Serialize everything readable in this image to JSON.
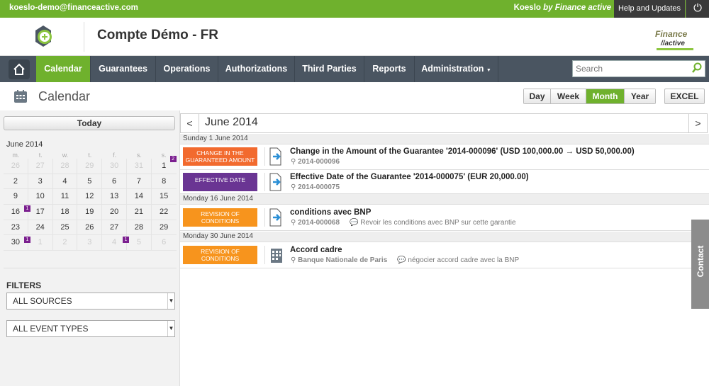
{
  "topbar": {
    "email": "koeslo-demo@financeactive.com",
    "brand_a": "Koeslo",
    "brand_b": "by Finance active",
    "help": "Help and Updates"
  },
  "header": {
    "title": "Compte Démo - FR"
  },
  "nav": {
    "items": [
      "Calendar",
      "Guarantees",
      "Operations",
      "Authorizations",
      "Third Parties",
      "Reports",
      "Administration"
    ],
    "search_placeholder": "Search"
  },
  "page": {
    "title": "Calendar",
    "views": [
      "Day",
      "Week",
      "Month",
      "Year"
    ],
    "active_view": "Month",
    "excel": "EXCEL"
  },
  "sidebar": {
    "today": "Today",
    "month_title": "June 2014",
    "dow": [
      "m.",
      "t.",
      "w.",
      "t.",
      "f.",
      "s.",
      "s."
    ],
    "weeks": [
      [
        "26",
        "27",
        "28",
        "29",
        "30",
        "31",
        "1"
      ],
      [
        "2",
        "3",
        "4",
        "5",
        "6",
        "7",
        "8"
      ],
      [
        "9",
        "10",
        "11",
        "12",
        "13",
        "14",
        "15"
      ],
      [
        "16",
        "17",
        "18",
        "19",
        "20",
        "21",
        "22"
      ],
      [
        "23",
        "24",
        "25",
        "26",
        "27",
        "28",
        "29"
      ],
      [
        "30",
        "1",
        "2",
        "3",
        "4",
        "5",
        "6"
      ]
    ],
    "badges": {
      "w0d6": "2",
      "w3d0": "1",
      "w5d0": "1",
      "w5d4": "1"
    },
    "filters_label": "FILTERS",
    "source_select": "ALL SOURCES",
    "type_select": "ALL EVENT TYPES"
  },
  "calendar": {
    "month": "June 2014",
    "days": [
      {
        "label": "Sunday 1 June 2014"
      },
      {
        "label": "Monday 16 June 2014"
      },
      {
        "label": "Monday 30 June 2014"
      }
    ],
    "events": [
      {
        "tag": "CHANGE IN THE GUARANTEED AMOUNT",
        "title": "Change in the Amount of the Guarantee '2014-000096' (USD 100,000.00 → USD 50,000.00)",
        "ref": "2014-000096",
        "comment": "",
        "color": "#f26a2e"
      },
      {
        "tag": "EFFECTIVE DATE",
        "title": "Effective Date of the Guarantee '2014-000075' (EUR 20,000.00)",
        "ref": "2014-000075",
        "comment": "",
        "color": "#6a3593"
      },
      {
        "tag": "REVISION OF CONDITIONS",
        "title": "conditions avec BNP",
        "ref": "2014-000068",
        "comment": "Revoir les conditions avec BNP sur cette garantie",
        "color": "#f7941d"
      },
      {
        "tag": "REVISION OF CONDITIONS",
        "title": "Accord cadre",
        "ref": "Banque Nationale de Paris",
        "comment": "négocier accord cadre avec la BNP",
        "color": "#f7941d"
      }
    ]
  },
  "contact": "Contact"
}
